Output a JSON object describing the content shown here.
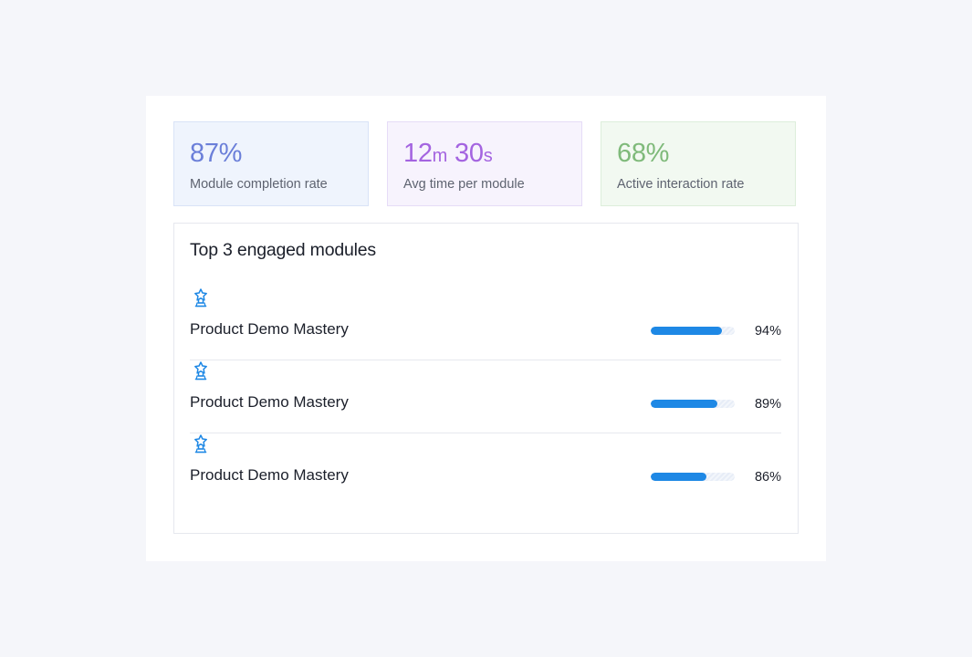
{
  "stats": [
    {
      "value_main": "87%",
      "label": "Module completion rate",
      "color": "#6b7fd9",
      "bg": "#eff4fd",
      "border": "#d9e3f7"
    },
    {
      "minutes": "12",
      "minutes_unit": "m",
      "seconds": "30",
      "seconds_unit": "s",
      "label": "Avg time per module",
      "color": "#a464e0",
      "bg": "#f7f3fd",
      "border": "#e6dcf7"
    },
    {
      "value_main": "68%",
      "label": "Active interaction rate",
      "color": "#7fba7a",
      "bg": "#f2f9f1",
      "border": "#ddeedb"
    }
  ],
  "modules": {
    "title": "Top 3 engaged modules",
    "accent_color": "#1e88e5",
    "items": [
      {
        "icon": "trophy-icon",
        "name": "Product Demo Mastery",
        "percent_label": "94%",
        "progress": 0.85
      },
      {
        "icon": "trophy-icon",
        "name": "Product Demo Mastery",
        "percent_label": "89%",
        "progress": 0.79
      },
      {
        "icon": "trophy-icon",
        "name": "Product Demo Mastery",
        "percent_label": "86%",
        "progress": 0.66
      }
    ]
  }
}
